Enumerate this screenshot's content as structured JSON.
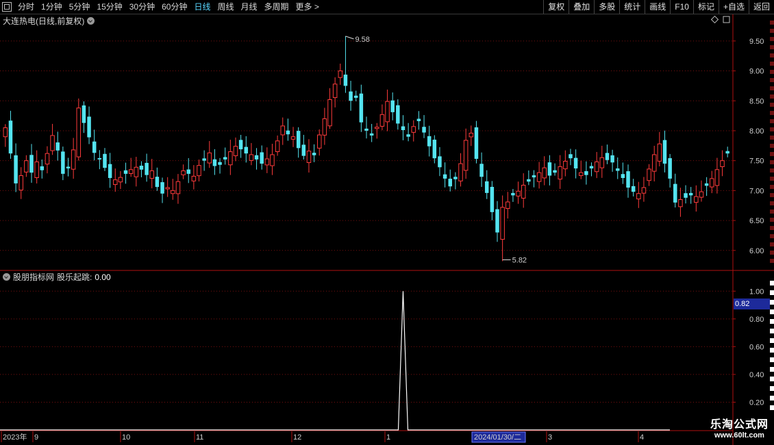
{
  "toolbar": {
    "left_items": [
      {
        "label": "分时",
        "active": false
      },
      {
        "label": "1分钟",
        "active": false
      },
      {
        "label": "5分钟",
        "active": false
      },
      {
        "label": "15分钟",
        "active": false
      },
      {
        "label": "30分钟",
        "active": false
      },
      {
        "label": "60分钟",
        "active": false
      },
      {
        "label": "日线",
        "active": true
      },
      {
        "label": "周线",
        "active": false
      },
      {
        "label": "月线",
        "active": false
      },
      {
        "label": "多周期",
        "active": false
      },
      {
        "label": "更多",
        "active": false
      }
    ],
    "more_glyph": ">",
    "right_buttons": [
      "复权",
      "叠加",
      "多股",
      "统计",
      "画线",
      "F10",
      "标记",
      "+自选",
      "返回"
    ]
  },
  "main_chart": {
    "title": "大连热电(日线,前复权)",
    "price_labels": [
      "9.50",
      "9.00",
      "8.50",
      "8.00",
      "7.50",
      "7.00",
      "6.50",
      "6.00"
    ],
    "high_marker": "9.58",
    "low_marker": "5.82",
    "colors": {
      "up": "#ff3b3b",
      "down": "#54e4f0",
      "grid": "#7a1010",
      "axis": "#b01010"
    }
  },
  "indicator": {
    "name": "股朋指标网",
    "series_label": "股乐起跳:",
    "value": "0.00",
    "axis_labels": [
      "1.00",
      "0.80",
      "0.60",
      "0.40",
      "0.20"
    ],
    "current_value": "0.82"
  },
  "date_axis": {
    "labels": [
      "2023年",
      "9",
      "10",
      "11",
      "12",
      "1",
      "3",
      "4"
    ],
    "cursor_date": "2024/01/30/二"
  },
  "watermark": {
    "line1": "乐淘公式网",
    "line2": "www.60lt.com"
  },
  "chart_data": [
    {
      "type": "candlestick",
      "title": "大连热电(日线,前复权)",
      "ylim": [
        5.7,
        9.75
      ],
      "ticks": [
        6.0,
        6.5,
        7.0,
        7.5,
        8.0,
        8.5,
        9.0,
        9.5
      ],
      "high_marker": 9.58,
      "low_marker": 5.82,
      "closes": [
        8.05,
        7.62,
        7.12,
        7.25,
        7.5,
        7.3,
        7.48,
        7.34,
        7.62,
        7.92,
        7.67,
        7.28,
        7.37,
        7.68,
        8.38,
        8.13,
        7.89,
        7.63,
        7.52,
        7.38,
        7.21,
        7.18,
        7.22,
        7.28,
        7.35,
        7.39,
        7.35,
        7.26,
        7.33,
        7.06,
        6.95,
        7.05,
        7.0,
        7.15,
        7.33,
        7.28,
        7.24,
        7.42,
        7.5,
        7.63,
        7.41,
        7.43,
        7.52,
        7.65,
        7.74,
        7.69,
        7.62,
        7.6,
        7.52,
        7.45,
        7.53,
        7.6,
        7.83,
        8.08,
        7.94,
        7.9,
        7.71,
        7.58,
        7.66,
        7.59,
        7.93,
        8.2,
        8.52,
        8.78,
        9.0,
        8.75,
        8.5,
        8.55,
        8.14,
        8.0,
        7.92,
        8.06,
        8.27,
        8.49,
        8.31,
        8.12,
        8.01,
        7.9,
        8.07,
        8.16,
        7.97,
        7.74,
        7.54,
        7.39,
        7.2,
        7.07,
        7.19,
        7.45,
        7.84,
        7.96,
        7.53,
        7.23,
        6.96,
        6.64,
        6.3,
        6.72,
        6.81,
        6.92,
        6.99,
        7.09,
        7.15,
        7.22,
        7.3,
        7.38,
        7.25,
        7.3,
        7.4,
        7.49,
        7.54,
        7.37,
        7.3,
        7.26,
        7.37,
        7.48,
        7.55,
        7.51,
        7.47,
        7.33,
        7.21,
        7.05,
        6.98,
        6.95,
        7.05,
        7.36,
        7.6,
        7.78,
        7.45,
        7.2,
        6.8,
        6.85,
        6.88,
        6.92,
        6.9,
        6.98,
        7.08,
        7.2,
        7.35,
        7.5,
        7.62
      ]
    },
    {
      "type": "line",
      "series": [
        {
          "name": "股乐起跳",
          "spike_value": 1.0,
          "baseline": 0.0
        }
      ],
      "ylim": [
        0,
        1.1
      ],
      "ticks": [
        0.2,
        0.4,
        0.6,
        0.8,
        1.0
      ]
    }
  ]
}
